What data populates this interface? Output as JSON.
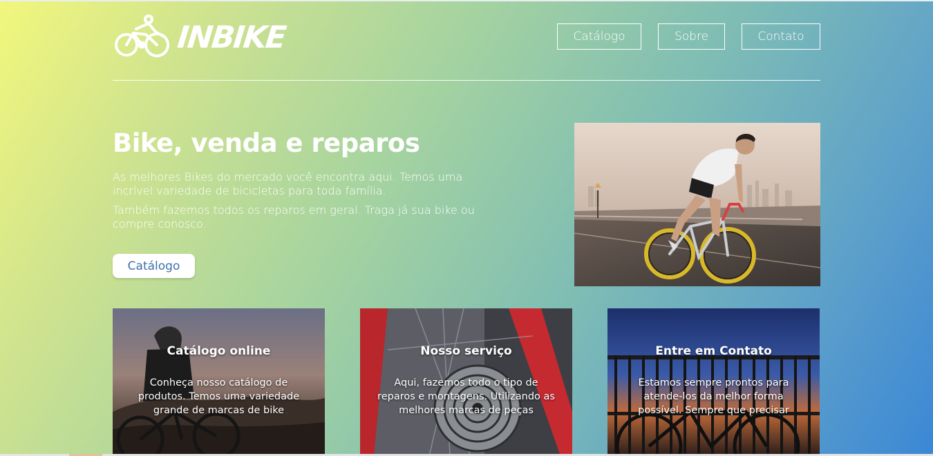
{
  "brand": {
    "name": "INBIKE",
    "logo_icon": "cyclist-logo-icon"
  },
  "nav": {
    "items": [
      "Catálogo",
      "Sobre",
      "Contato"
    ]
  },
  "hero": {
    "title": "Bike, venda e reparos",
    "paragraph1": "As melhores Bikes do mercado você encontra aqui. Temos uma incrível variedade de bicicletas para toda família.",
    "paragraph2": "Também fazemos todos os reparos em geral. Traga já sua bike ou compre conosco.",
    "cta": "Catálogo",
    "image": "cyclist-road-photo"
  },
  "cards": [
    {
      "title": "Catálogo online",
      "text": "Conheça nosso catálogo de produtos. Temos uma variedade grande de marcas de bike",
      "image": "mountain-biker-photo"
    },
    {
      "title": "Nosso serviço",
      "text": "Aqui, fazemos todo o tipo de reparos e montagens. Utilizando as melhores marcas de peças",
      "image": "bike-gears-photo"
    },
    {
      "title": "Entre em Contato",
      "text": "Estamos sempre prontos para atende-los da melhor forma possível. Sempre que precisar",
      "image": "bike-fence-photo"
    }
  ],
  "colors": {
    "gradient_start": "#f2f77c",
    "gradient_end": "#3b87d6",
    "button_text": "#3d6fae"
  }
}
